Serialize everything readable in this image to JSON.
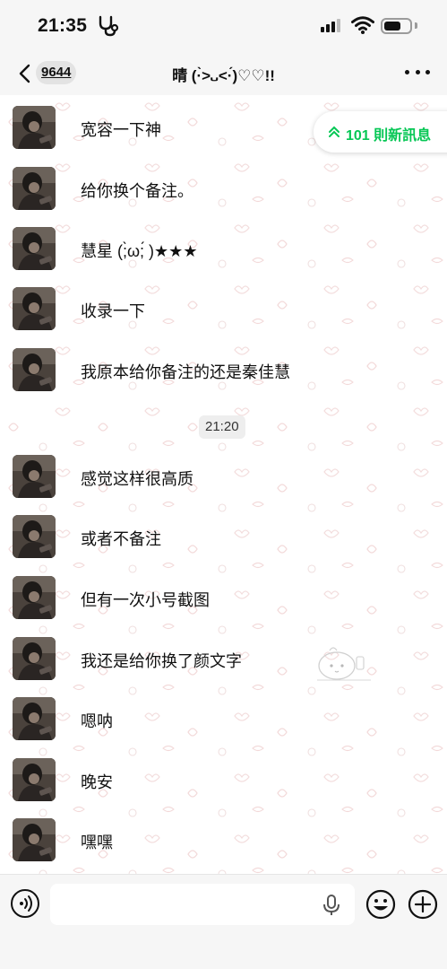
{
  "status_bar": {
    "time": "21:35",
    "signal_bars_filled": 3,
    "signal_bars_total": 4,
    "battery_level": 0.65
  },
  "nav": {
    "unread_count": "9644",
    "title": "晴 (·̀>᎑<·́)♡♡!!"
  },
  "new_messages": {
    "label": "101 則新訊息"
  },
  "messages": [
    {
      "text": "宽容一下神"
    },
    {
      "text": "给你换个备注。"
    },
    {
      "text": "慧星 (;̀ω;́ )★★★"
    },
    {
      "text": "收录一下"
    },
    {
      "text": "我原本给你备注的还是秦佳慧"
    },
    {
      "text": "感觉这样很高质"
    },
    {
      "text": "或者不备注"
    },
    {
      "text": "但有一次小号截图"
    },
    {
      "text": "我还是给你换了颜文字"
    },
    {
      "text": "嗯呐"
    },
    {
      "text": "晚安"
    },
    {
      "text": "嘿嘿"
    }
  ],
  "time_separator": "21:20",
  "input": {
    "value": "",
    "placeholder": ""
  },
  "icons": {
    "back": "chevron-left-icon",
    "more": "more-dots-icon",
    "voice": "voice-icon",
    "mic": "microphone-icon",
    "emoji": "emoji-icon",
    "plus": "plus-icon"
  },
  "colors": {
    "accent_green": "#06c755",
    "bar_background": "#f6f6f6"
  }
}
